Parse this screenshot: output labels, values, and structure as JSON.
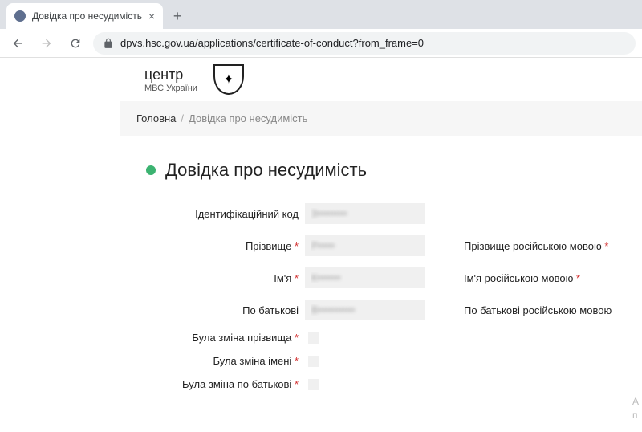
{
  "browser": {
    "tab_title": "Довідка про несудимість",
    "url_display": "dpvs.hsc.gov.ua/applications/certificate-of-conduct?from_frame=0"
  },
  "header": {
    "logo_title": "центр",
    "logo_subtitle": "МВС України"
  },
  "breadcrumb": {
    "home": "Головна",
    "current": "Довідка про несудимість"
  },
  "page_title": "Довідка про несудимість",
  "form": {
    "labels": {
      "id_code": "Ідентифікаційний код",
      "surname": "Прізвище",
      "surname_ru": "Прізвище російською мовою",
      "name": "Ім'я",
      "name_ru": "Ім'я російською мовою",
      "patronymic": "По батькові",
      "patronymic_ru": "По батькові російською мовою",
      "surname_changed": "Була зміна прізвища",
      "name_changed": "Була зміна імені",
      "patronymic_changed": "Була зміна по батькові"
    },
    "values": {
      "id_code": "3•••••••••",
      "surname": "Р•••••",
      "name": "К•••••••",
      "patronymic": "В•••••••••••"
    }
  },
  "side_hint": {
    "line1": "А",
    "line2": "п"
  }
}
